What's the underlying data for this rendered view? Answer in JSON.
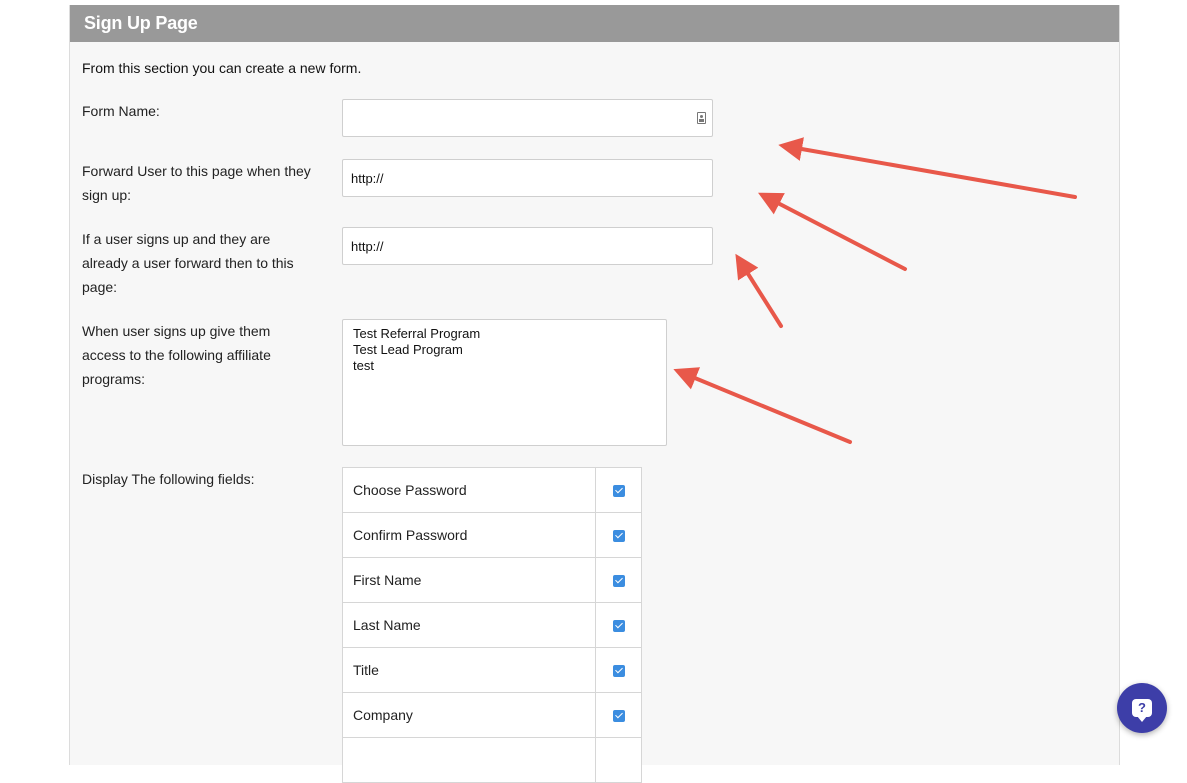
{
  "panel": {
    "title": "Sign Up Page",
    "intro": "From this section you can create a new form."
  },
  "form": {
    "form_name_label": "Form Name:",
    "form_name_value": "",
    "forward_label_1": "Forward User to this page when they",
    "forward_label_2": "sign up:",
    "forward_value": "http://",
    "existing_label_1": "If a user signs up and they are",
    "existing_label_2": "already a user forward then to this",
    "existing_label_3": "page:",
    "existing_value": "http://",
    "programs_label_1": "When user signs up give them",
    "programs_label_2": "access to the following affiliate",
    "programs_label_3": "programs:",
    "programs": [
      "Test Referral Program",
      "Test Lead Program",
      "test"
    ],
    "display_fields_label": "Display The following fields:",
    "fields": [
      {
        "label": "Choose Password",
        "checked": true
      },
      {
        "label": "Confirm Password",
        "checked": true
      },
      {
        "label": "First Name",
        "checked": true
      },
      {
        "label": "Last Name",
        "checked": true
      },
      {
        "label": "Title",
        "checked": true
      },
      {
        "label": "Company",
        "checked": true
      }
    ]
  },
  "help": {
    "icon": "help-chat-icon",
    "glyph": "?"
  },
  "colors": {
    "header": "#999999",
    "arrow": "#e8584a",
    "checkbox": "#3b8de0",
    "help": "#3d3ea8"
  }
}
